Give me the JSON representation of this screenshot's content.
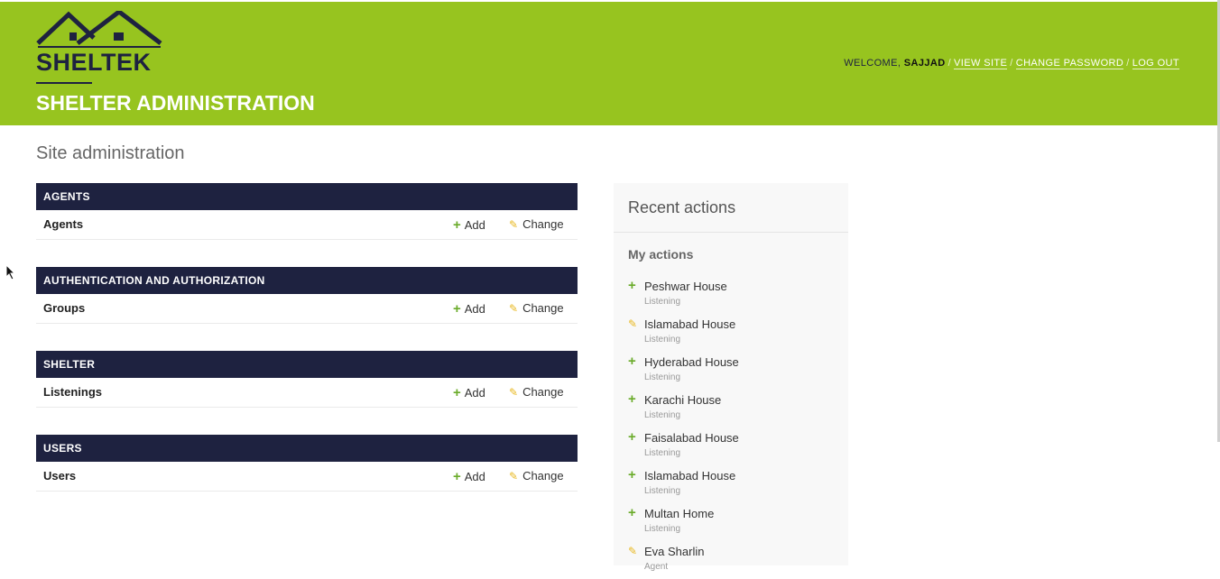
{
  "header": {
    "brand": "SHELTEK",
    "site_title": "SHELTER ADMINISTRATION",
    "welcome_label": "WELCOME,",
    "username": "SAJJAD",
    "links": {
      "view_site": "VIEW SITE",
      "change_password": "CHANGE PASSWORD",
      "log_out": "LOG OUT"
    },
    "separator": "/",
    "colors": {
      "header_bg": "#97c41f",
      "logo_navy": "#1e2240"
    }
  },
  "page": {
    "heading": "Site administration"
  },
  "modules": [
    {
      "caption": "AGENTS",
      "model": "Agents",
      "add": "Add",
      "change": "Change"
    },
    {
      "caption": "AUTHENTICATION AND AUTHORIZATION",
      "model": "Groups",
      "add": "Add",
      "change": "Change"
    },
    {
      "caption": "SHELTER",
      "model": "Listenings",
      "add": "Add",
      "change": "Change"
    },
    {
      "caption": "USERS",
      "model": "Users",
      "add": "Add",
      "change": "Change"
    }
  ],
  "recent_actions": {
    "title": "Recent actions",
    "subtitle": "My actions",
    "items": [
      {
        "icon": "add-icon",
        "name": "Peshwar House",
        "type": "Listening"
      },
      {
        "icon": "change-icon",
        "name": "Islamabad House",
        "type": "Listening"
      },
      {
        "icon": "add-icon",
        "name": "Hyderabad House",
        "type": "Listening"
      },
      {
        "icon": "add-icon",
        "name": "Karachi House",
        "type": "Listening"
      },
      {
        "icon": "add-icon",
        "name": "Faisalabad House",
        "type": "Listening"
      },
      {
        "icon": "add-icon",
        "name": "Islamabad House",
        "type": "Listening"
      },
      {
        "icon": "add-icon",
        "name": "Multan Home",
        "type": "Listening"
      },
      {
        "icon": "change-icon",
        "name": "Eva Sharlin",
        "type": "Agent"
      }
    ]
  },
  "colors": {
    "module_caption_bg": "#1e2240",
    "add_icon": "#6aab2a",
    "change_icon": "#e8b820"
  }
}
